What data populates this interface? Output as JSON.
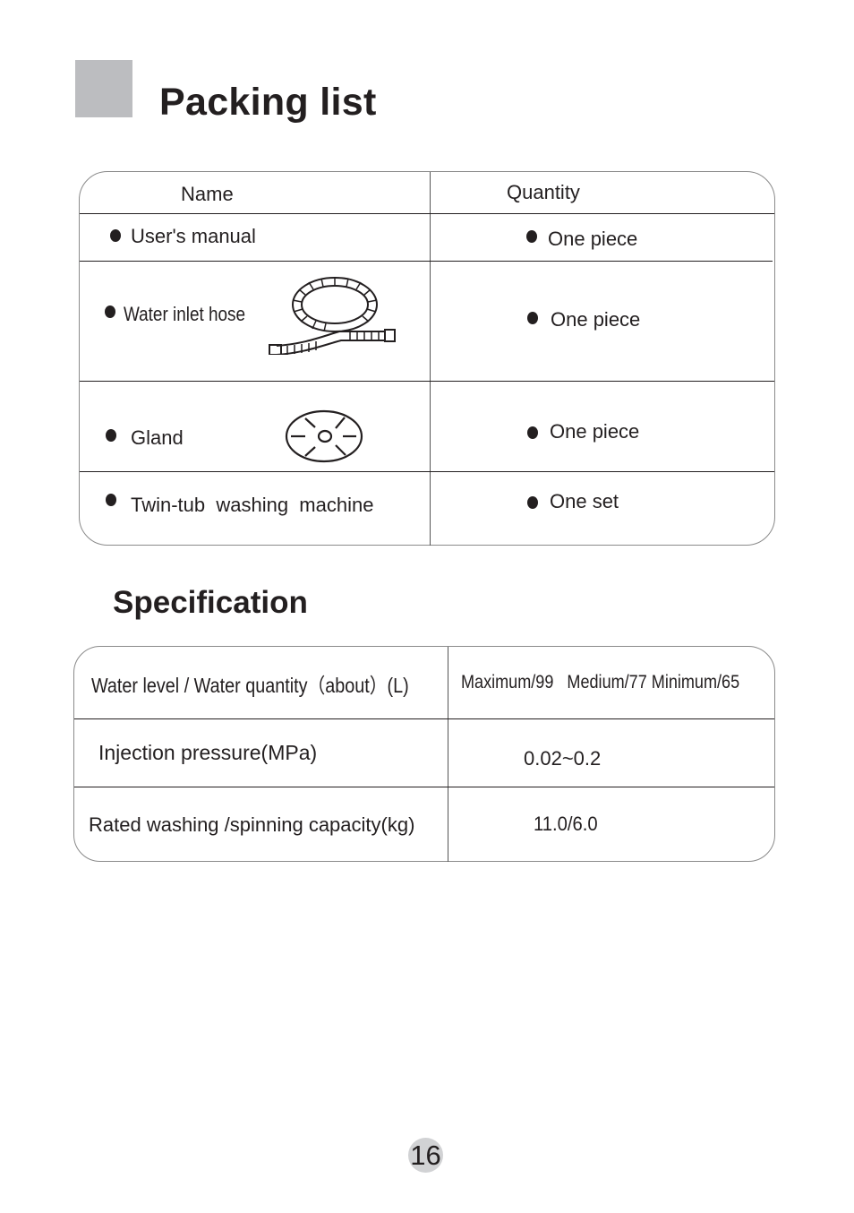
{
  "packing": {
    "title": "Packing list",
    "header": {
      "name": "Name",
      "quantity": "Quantity"
    },
    "rows": [
      {
        "name": "User's manual",
        "quantity": "One piece",
        "icon": ""
      },
      {
        "name": "Water inlet hose",
        "quantity": "One piece",
        "icon": "hose-icon"
      },
      {
        "name": "Gland",
        "quantity": "One piece",
        "icon": "gland-icon"
      },
      {
        "name": "Twin-tub  washing  machine",
        "quantity": "One set",
        "icon": ""
      }
    ]
  },
  "specification": {
    "title": "Specification",
    "rows": [
      {
        "label": "Water level / Water quantity（about）(L)",
        "value": "Maximum/99   Medium/77 Minimum/65"
      },
      {
        "label": "Injection pressure(MPa)",
        "value": "0.02~0.2"
      },
      {
        "label": "Rated washing /spinning capacity(kg)",
        "value": "11.0/6.0"
      }
    ]
  },
  "page_number": "16",
  "colors": {
    "accent_gray": "#bcbdc0",
    "page_badge": "#d1d2d4",
    "text": "#231f20"
  }
}
